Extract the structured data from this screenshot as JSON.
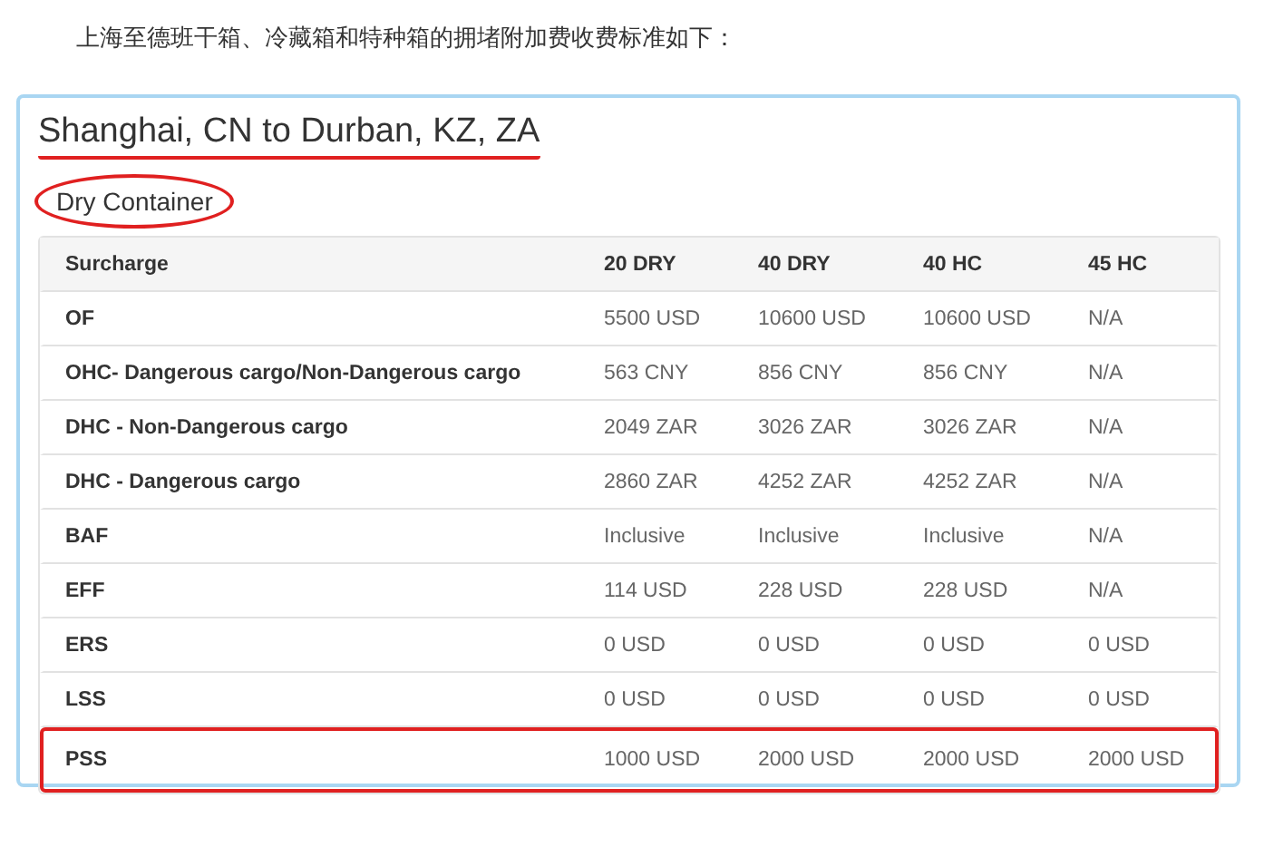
{
  "intro": "上海至德班干箱、冷藏箱和特种箱的拥堵附加费收费标准如下：",
  "card": {
    "title": "Shanghai, CN to Durban, KZ, ZA",
    "title_underlined": true,
    "section": "Dry Container",
    "section_circled": true
  },
  "table": {
    "columns": [
      "Surcharge",
      "20 DRY",
      "40 DRY",
      "40 HC",
      "45 HC"
    ],
    "rows": [
      {
        "cells": [
          "OF",
          "5500 USD",
          "10600 USD",
          "10600 USD",
          "N/A"
        ],
        "highlighted": false
      },
      {
        "cells": [
          "OHC- Dangerous cargo/Non-Dangerous cargo",
          "563 CNY",
          "856 CNY",
          "856 CNY",
          "N/A"
        ],
        "highlighted": false
      },
      {
        "cells": [
          "DHC - Non-Dangerous cargo",
          "2049 ZAR",
          "3026 ZAR",
          "3026 ZAR",
          "N/A"
        ],
        "highlighted": false
      },
      {
        "cells": [
          "DHC - Dangerous cargo",
          "2860 ZAR",
          "4252 ZAR",
          "4252 ZAR",
          "N/A"
        ],
        "highlighted": false
      },
      {
        "cells": [
          "BAF",
          "Inclusive",
          "Inclusive",
          "Inclusive",
          "N/A"
        ],
        "highlighted": false
      },
      {
        "cells": [
          "EFF",
          "114 USD",
          "228 USD",
          "228 USD",
          "N/A"
        ],
        "highlighted": false
      },
      {
        "cells": [
          "ERS",
          "0 USD",
          "0 USD",
          "0 USD",
          "0 USD"
        ],
        "highlighted": false
      },
      {
        "cells": [
          "LSS",
          "0 USD",
          "0 USD",
          "0 USD",
          "0 USD"
        ],
        "highlighted": false
      },
      {
        "cells": [
          "PSS",
          "1000 USD",
          "2000 USD",
          "2000 USD",
          "2000 USD"
        ],
        "highlighted": true
      }
    ]
  }
}
